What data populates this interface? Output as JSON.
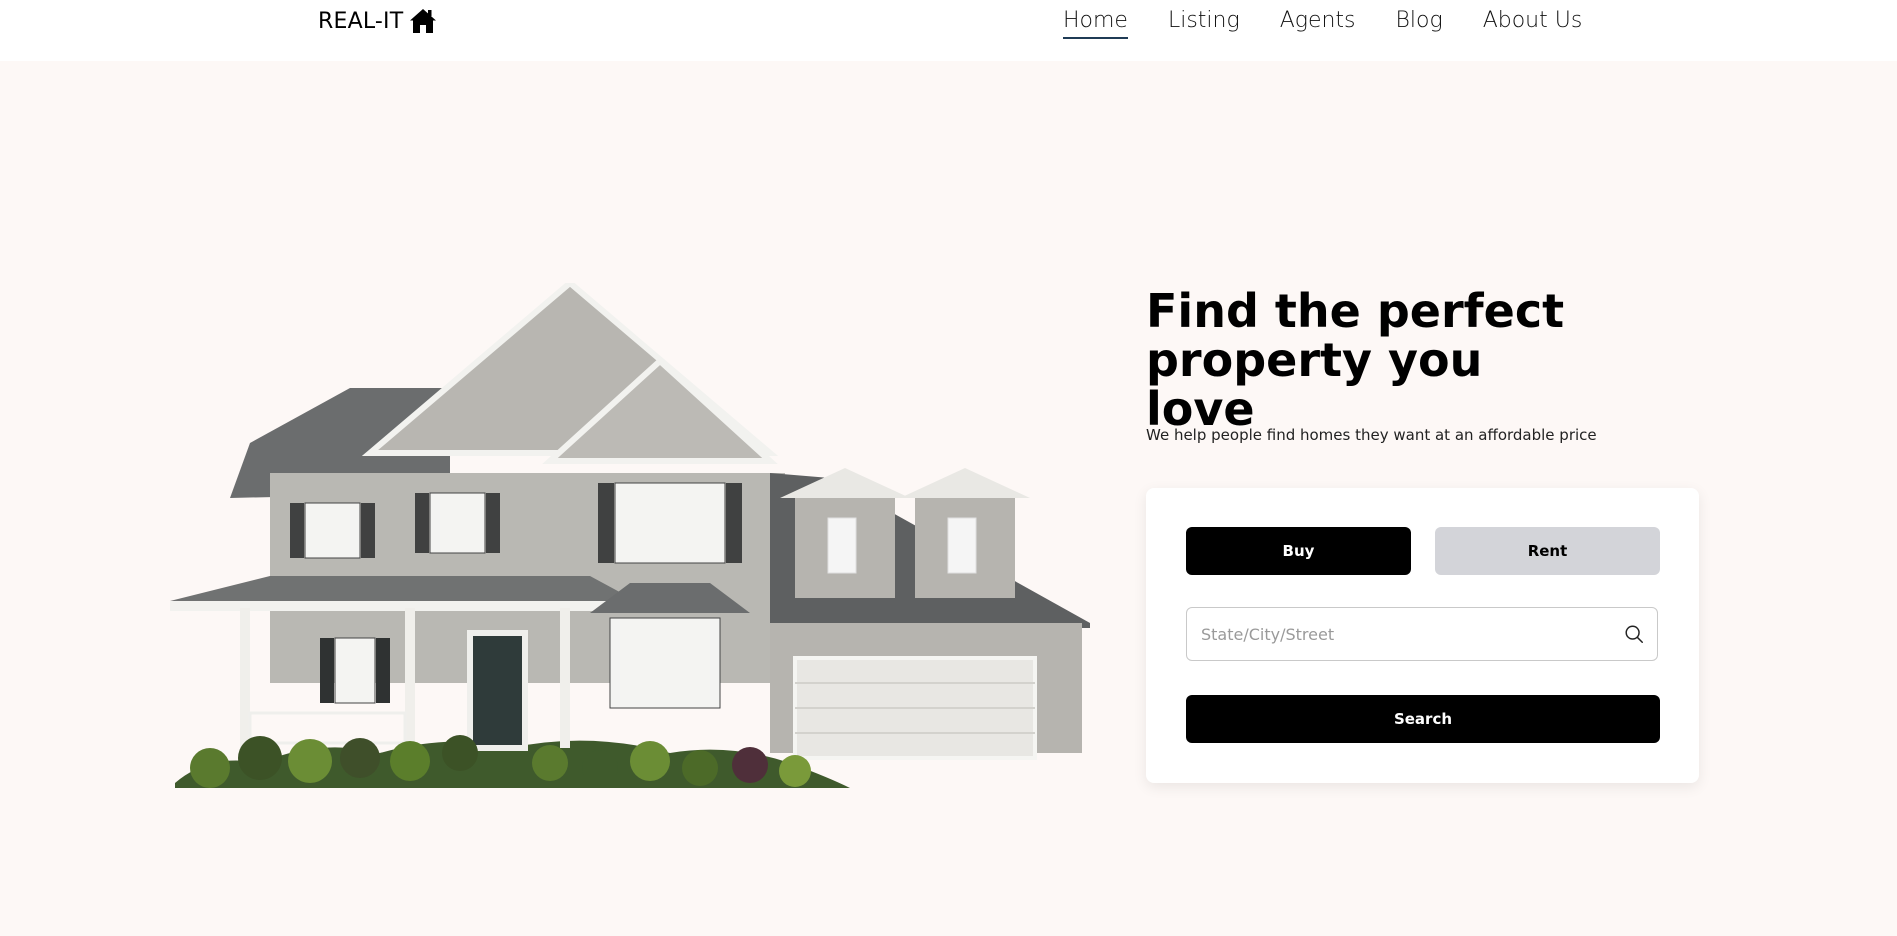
{
  "header": {
    "logo_text": "REAL-IT",
    "logo_icon": "home-icon",
    "nav": [
      {
        "label": "Home",
        "active": true
      },
      {
        "label": "Listing",
        "active": false
      },
      {
        "label": "Agents",
        "active": false
      },
      {
        "label": "Blog",
        "active": false
      },
      {
        "label": "About Us",
        "active": false
      }
    ]
  },
  "hero": {
    "headline": "Find the perfect property you love",
    "subtext": "We help people find homes they want at an affordable price",
    "image": "house-photo"
  },
  "search_card": {
    "tabs": {
      "buy_label": "Buy",
      "rent_label": "Rent",
      "selected": "Buy"
    },
    "input": {
      "placeholder": "State/City/Street",
      "value": "",
      "icon": "search-icon"
    },
    "submit_label": "Search"
  },
  "colors": {
    "page_background": "#fdf8f6",
    "header_background": "#ffffff",
    "primary_button": "#000000",
    "secondary_button": "#d3d4d9",
    "nav_active_underline": "#1f3b55"
  }
}
